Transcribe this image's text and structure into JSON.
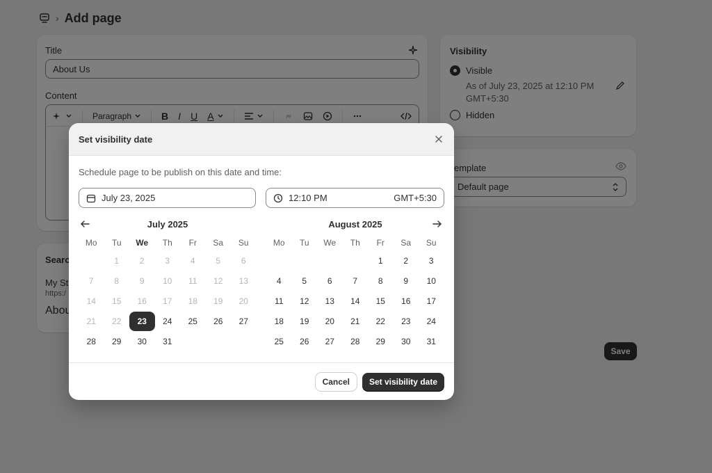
{
  "header": {
    "breadcrumb_icon": "pages-icon",
    "separator": "›",
    "title": "Add page"
  },
  "editor_card": {
    "title_label": "Title",
    "title_value": "About Us",
    "content_label": "Content",
    "toolbar": {
      "paragraph_label": "Paragraph",
      "bold": "B",
      "italic": "I",
      "underline": "U",
      "text_color": "A"
    }
  },
  "seo_card": {
    "label": "Searc",
    "site": "My St",
    "url": "https:/",
    "page": "Abou"
  },
  "visibility_card": {
    "title": "Visibility",
    "visible_label": "Visible",
    "visible_date_line1": "As of July 23, 2025 at 12:10 PM",
    "visible_date_line2": "GMT+5:30",
    "hidden_label": "Hidden"
  },
  "template_card": {
    "label": "emplate",
    "value": "Default page"
  },
  "save_button": "Save",
  "modal": {
    "title": "Set visibility date",
    "description": "Schedule page to be publish on this date and time:",
    "date_value": "July 23, 2025",
    "time_value": "12:10 PM",
    "timezone": "GMT+5:30",
    "weekdays": [
      "Mo",
      "Tu",
      "We",
      "Th",
      "Fr",
      "Sa",
      "Su"
    ],
    "months": [
      {
        "title": "July 2025",
        "today_weekday_index": 2,
        "selected_day": 23,
        "weeks": [
          [
            null,
            "1",
            "2",
            "3",
            "4",
            "5",
            "6"
          ],
          [
            "7",
            "8",
            "9",
            "10",
            "11",
            "12",
            "13"
          ],
          [
            "14",
            "15",
            "16",
            "17",
            "18",
            "19",
            "20"
          ],
          [
            "21",
            "22",
            "23",
            "24",
            "25",
            "26",
            "27"
          ],
          [
            "28",
            "29",
            "30",
            "31",
            null,
            null,
            null
          ]
        ],
        "disabled_before": 23
      },
      {
        "title": "August 2025",
        "today_weekday_index": -1,
        "selected_day": null,
        "weeks": [
          [
            null,
            null,
            null,
            null,
            "1",
            "2",
            "3"
          ],
          [
            "4",
            "5",
            "6",
            "7",
            "8",
            "9",
            "10"
          ],
          [
            "11",
            "12",
            "13",
            "14",
            "15",
            "16",
            "17"
          ],
          [
            "18",
            "19",
            "20",
            "21",
            "22",
            "23",
            "24"
          ],
          [
            "25",
            "26",
            "27",
            "28",
            "29",
            "30",
            "31"
          ]
        ],
        "disabled_before": 0
      }
    ],
    "cancel_label": "Cancel",
    "confirm_label": "Set visibility date"
  },
  "colors": {
    "overlay": "#000000",
    "primary": "#303030",
    "disabled": "#b5b5b5",
    "page_bg": "#f1f1f1"
  }
}
